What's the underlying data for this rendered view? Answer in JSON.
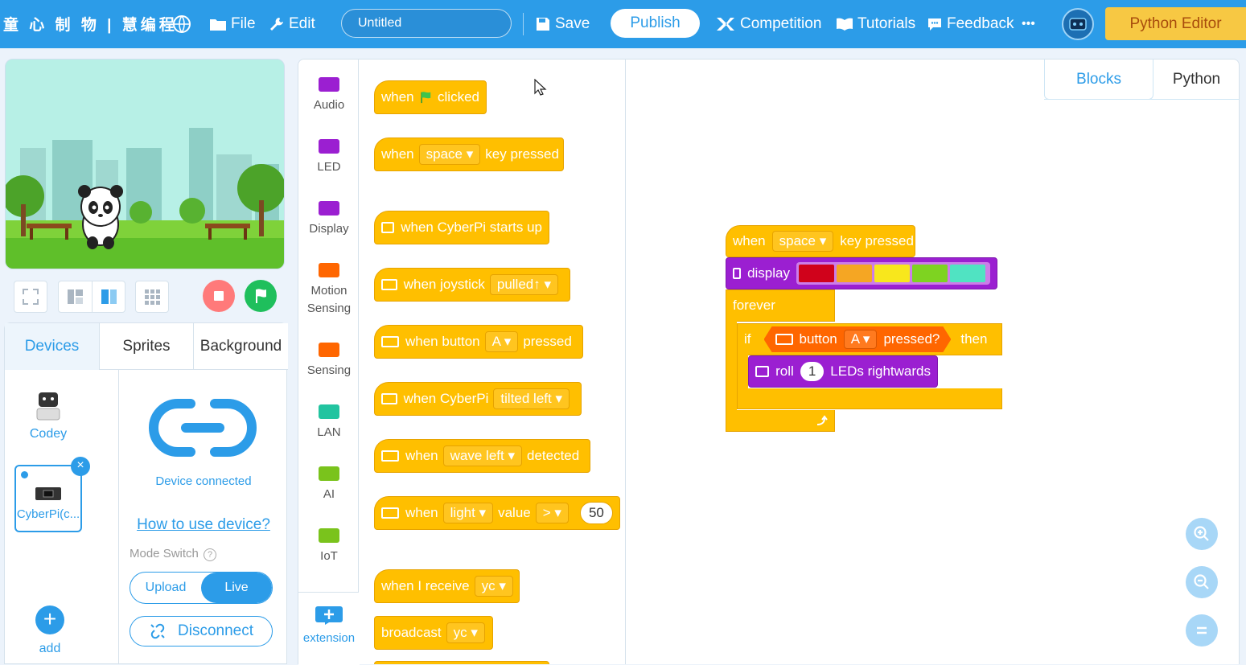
{
  "topbar": {
    "brand": "童 心 制 物 | 慧编程",
    "file": "File",
    "edit": "Edit",
    "project_title": "Untitled",
    "save": "Save",
    "publish": "Publish",
    "competition": "Competition",
    "tutorials": "Tutorials",
    "feedback": "Feedback",
    "more": "•••",
    "python_editor": "Python Editor"
  },
  "panel": {
    "tabs": [
      "Devices",
      "Sprites",
      "Background"
    ],
    "devices": [
      {
        "label": "Codey"
      },
      {
        "label": "CyberPi(c..."
      }
    ],
    "add": "add",
    "connected": "Device connected",
    "how_to": "How to use device?",
    "mode_switch": "Mode Switch",
    "upload": "Upload",
    "live": "Live",
    "disconnect": "Disconnect"
  },
  "categories": [
    {
      "label": "Audio",
      "color": "#9b1fd1"
    },
    {
      "label": "LED",
      "color": "#9b1fd1"
    },
    {
      "label": "Display",
      "color": "#9b1fd1"
    },
    {
      "label": "Motion Sensing",
      "color": "#ff6600"
    },
    {
      "label": "Sensing",
      "color": "#ff6600"
    },
    {
      "label": "LAN",
      "color": "#22c4a0"
    },
    {
      "label": "AI",
      "color": "#7ac31c"
    },
    {
      "label": "IoT",
      "color": "#7ac31c"
    }
  ],
  "extension": "extension",
  "palette": {
    "b1": {
      "a": "when",
      "b": "clicked"
    },
    "b2": {
      "a": "when",
      "b": "space",
      "c": "key pressed"
    },
    "b3": {
      "a": "when CyberPi starts up"
    },
    "b4": {
      "a": "when joystick",
      "b": "pulled↑"
    },
    "b5": {
      "a": "when button",
      "b": "A",
      "c": "pressed"
    },
    "b6": {
      "a": "when CyberPi",
      "b": "tilted left"
    },
    "b7": {
      "a": "when",
      "b": "wave left",
      "c": "detected"
    },
    "b8": {
      "a": "when",
      "b": "light",
      "c": "value",
      "d": ">",
      "e": "50"
    },
    "b9": {
      "a": "when I receive",
      "b": "yc"
    },
    "b10": {
      "a": "broadcast",
      "b": "yc"
    }
  },
  "workspace": {
    "tabs": [
      "Blocks",
      "Python"
    ],
    "hat": {
      "a": "when",
      "b": "space",
      "c": "key pressed"
    },
    "display": {
      "label": "display",
      "colors": [
        "#d0021b",
        "#f5a623",
        "#f8e71c",
        "#7ed321",
        "#50e3c2"
      ]
    },
    "forever": "forever",
    "if_label": "if",
    "cond": {
      "a": "button",
      "b": "A",
      "c": "pressed?"
    },
    "then": "then",
    "roll": {
      "a": "roll",
      "b": "1",
      "c": "LEDs rightwards"
    }
  },
  "colors": {
    "accent": "#2c9ce8",
    "event_block": "#ffbf00",
    "looks_block": "#9b1fd1",
    "sensing_block": "#ff6600",
    "python_button": "#f7c843"
  }
}
